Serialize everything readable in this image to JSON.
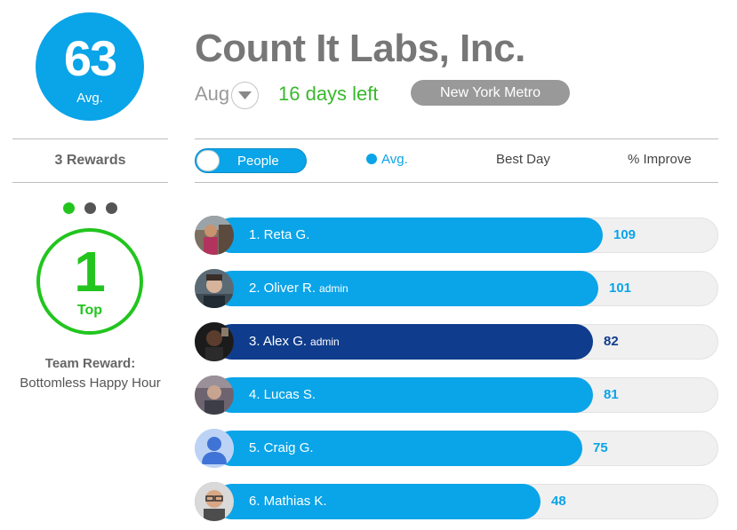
{
  "summary": {
    "avg_value": "63",
    "avg_label": "Avg."
  },
  "rewards": {
    "label": "3 Rewards",
    "dots": 3,
    "active_dot": 0
  },
  "top": {
    "value": "1",
    "label": "Top"
  },
  "team_reward": {
    "title": "Team Reward:",
    "value": "Bottomless Happy Hour"
  },
  "header": {
    "company": "Count It Labs, Inc.",
    "month": "Aug",
    "days_left": "16 days left",
    "region": "New York Metro"
  },
  "controls": {
    "toggle_label": "People",
    "sort_avg": "Avg.",
    "sort_best_day": "Best Day",
    "sort_improve": "% Improve"
  },
  "leaderboard": [
    {
      "rank_name": "1. Reta G.",
      "role": "",
      "value": "109",
      "fill": 0.78,
      "self": false,
      "avatar": "photo"
    },
    {
      "rank_name": "2. Oliver R.",
      "role": "admin",
      "value": "101",
      "fill": 0.77,
      "self": false,
      "avatar": "photo"
    },
    {
      "rank_name": "3. Alex G.",
      "role": "admin",
      "value": "82",
      "fill": 0.76,
      "self": true,
      "avatar": "photo"
    },
    {
      "rank_name": "4. Lucas S.",
      "role": "",
      "value": "81",
      "fill": 0.76,
      "self": false,
      "avatar": "photo"
    },
    {
      "rank_name": "5. Craig G.",
      "role": "",
      "value": "75",
      "fill": 0.74,
      "self": false,
      "avatar": "default-person"
    },
    {
      "rank_name": "6. Mathias K.",
      "role": "",
      "value": "48",
      "fill": 0.66,
      "self": false,
      "avatar": "photo"
    }
  ],
  "colors": {
    "accent": "#0aa4e8",
    "self_bar": "#0f3c8c",
    "green": "#22c51e",
    "days_left": "#3ab82d"
  }
}
